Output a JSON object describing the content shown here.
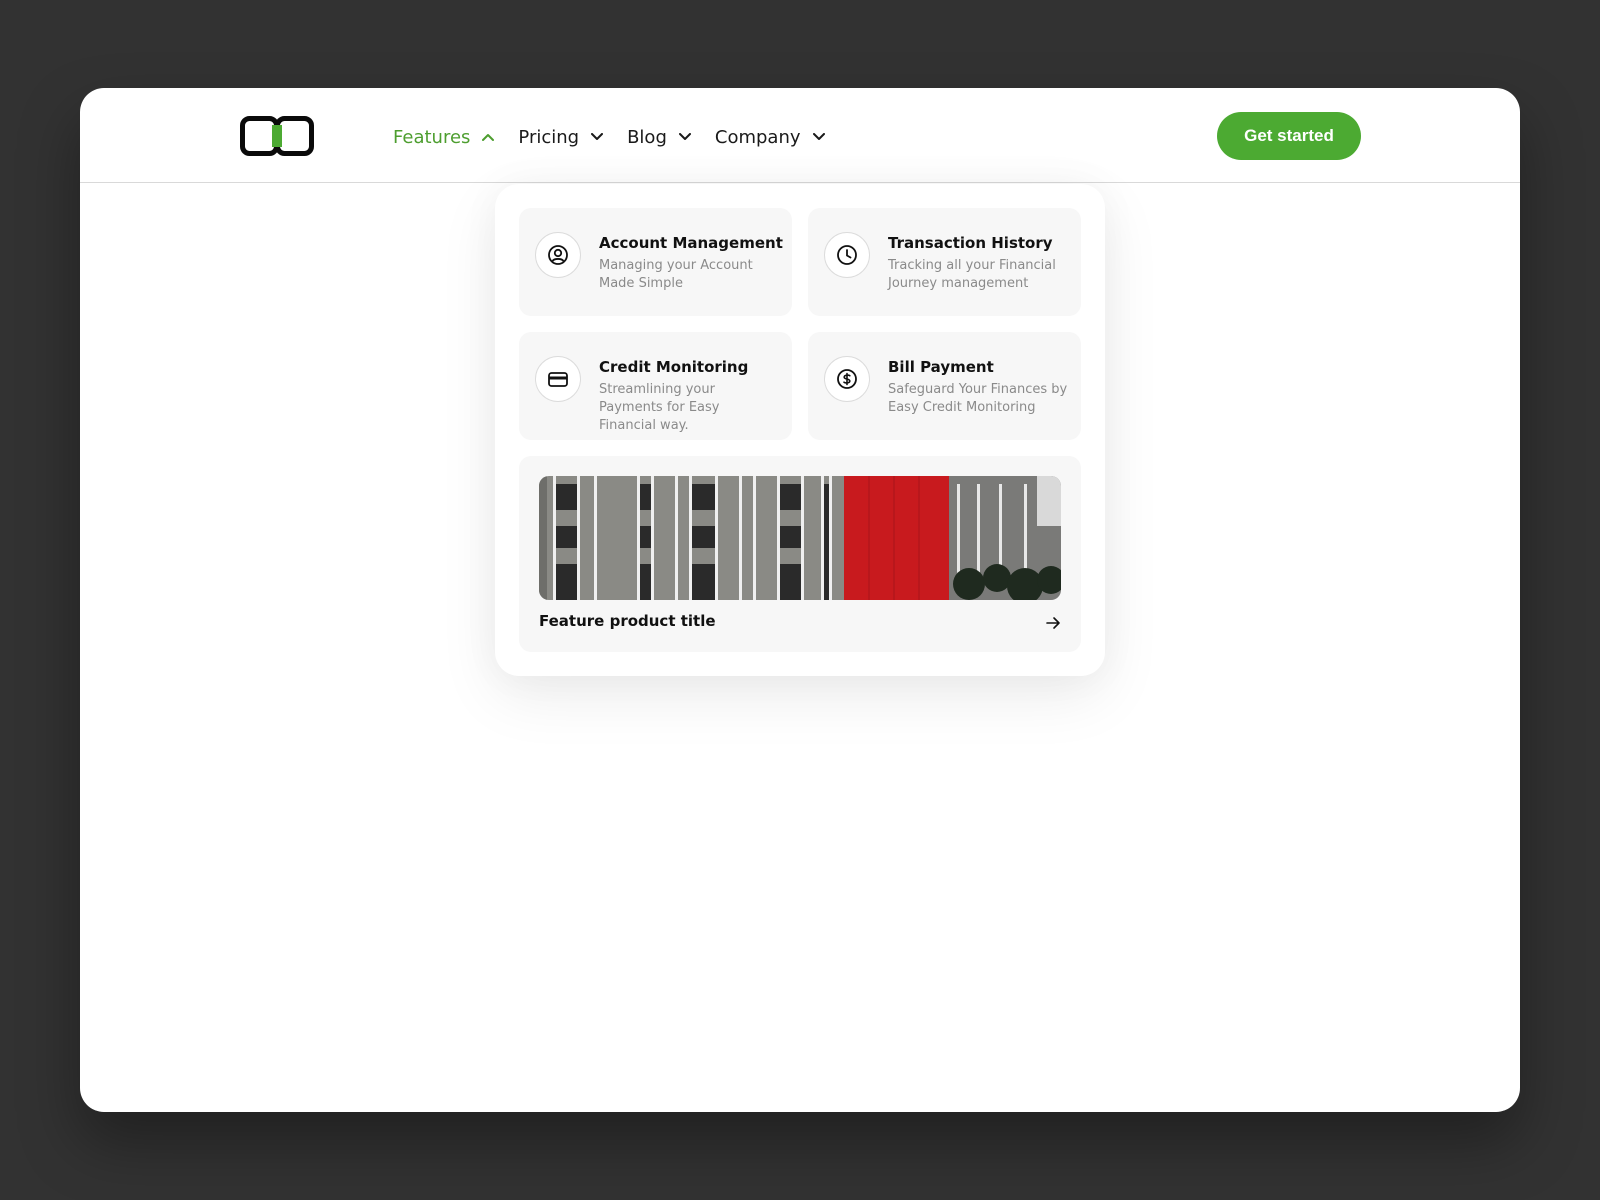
{
  "nav": {
    "items": [
      {
        "label": "Features",
        "active": true
      },
      {
        "label": "Pricing",
        "active": false
      },
      {
        "label": "Blog",
        "active": false
      },
      {
        "label": "Company",
        "active": false
      }
    ]
  },
  "cta": {
    "label": "Get started"
  },
  "dropdown": {
    "cards": [
      {
        "icon": "user-circle-icon",
        "title": "Account Management",
        "description": "Managing your Account Made Simple"
      },
      {
        "icon": "clock-icon",
        "title": "Transaction History",
        "description": "Tracking all your Financial Journey management"
      },
      {
        "icon": "credit-card-icon",
        "title": "Credit Monitoring",
        "description": "Streamlining your Payments for Easy Financial way."
      },
      {
        "icon": "dollar-circle-icon",
        "title": "Bill Payment",
        "description": "Safeguard Your Finances by Easy Credit Monitoring"
      }
    ],
    "feature": {
      "title": "Feature product title",
      "image": "building-facade-photo",
      "arrow_icon": "arrow-right-icon"
    }
  },
  "colors": {
    "accent": "#4caa32",
    "active_nav": "#4d9e2f",
    "background": "#323232",
    "card": "#f7f7f7"
  }
}
